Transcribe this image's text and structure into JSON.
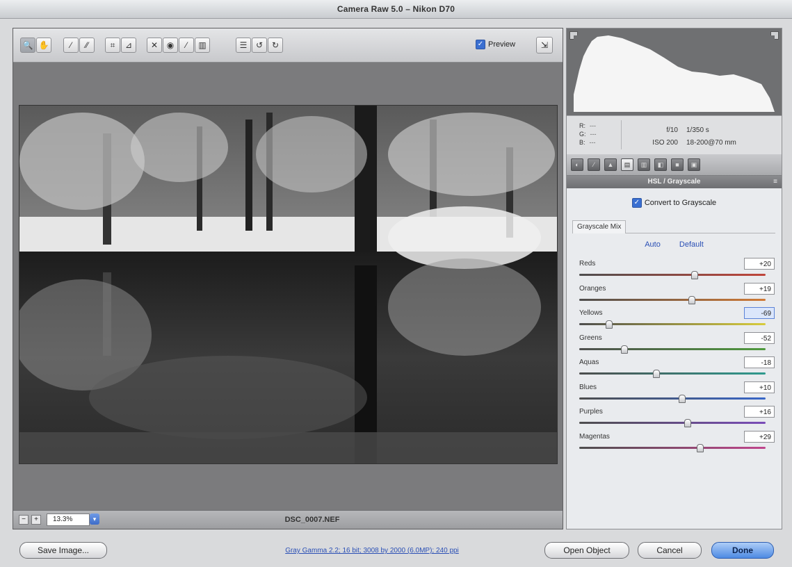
{
  "window": {
    "title": "Camera Raw 5.0  –  Nikon D70"
  },
  "toolbar": {
    "tools": [
      {
        "icon": "zoom-tool-icon",
        "glyph": "🔍"
      },
      {
        "icon": "hand-tool-icon",
        "glyph": "✋"
      },
      {
        "icon": "white-balance-tool-icon",
        "glyph": "⁄"
      },
      {
        "icon": "color-sampler-tool-icon",
        "glyph": "⁄⁄"
      },
      {
        "icon": "crop-tool-icon",
        "glyph": "⌗"
      },
      {
        "icon": "straighten-tool-icon",
        "glyph": "⊿"
      },
      {
        "icon": "spot-removal-tool-icon",
        "glyph": "✕"
      },
      {
        "icon": "red-eye-tool-icon",
        "glyph": "◉"
      },
      {
        "icon": "adjustment-brush-icon",
        "glyph": "⁄"
      },
      {
        "icon": "graduated-filter-icon",
        "glyph": "▥"
      },
      {
        "icon": "preferences-icon",
        "glyph": "☰"
      },
      {
        "icon": "rotate-ccw-icon",
        "glyph": "↺"
      },
      {
        "icon": "rotate-cw-icon",
        "glyph": "↻"
      }
    ],
    "preview_label": "Preview",
    "preview_checked": true,
    "fullscreen_glyph": "⇲"
  },
  "status": {
    "zoom_out_glyph": "−",
    "zoom_in_glyph": "+",
    "zoom_value": "13.3%",
    "filename": "DSC_0007.NEF"
  },
  "readout": {
    "rgb": [
      {
        "label": "R:",
        "value": "---"
      },
      {
        "label": "G:",
        "value": "---"
      },
      {
        "label": "B:",
        "value": "---"
      }
    ],
    "aperture": "f/10",
    "shutter": "1/350 s",
    "iso": "ISO 200",
    "lens": "18-200@70 mm"
  },
  "panel_tabs": [
    "basic-icon",
    "tone-curve-icon",
    "detail-icon",
    "hsl-icon",
    "split-toning-icon",
    "lens-corrections-icon",
    "camera-calibration-icon",
    "presets-icon"
  ],
  "panel": {
    "title": "HSL / Grayscale",
    "menu_glyph": "≡",
    "convert_label": "Convert to Grayscale",
    "mix_title": "Grayscale Mix",
    "auto_label": "Auto",
    "default_label": "Default",
    "sliders": [
      {
        "label": "Reds",
        "value": "+20",
        "fraction": 0.615,
        "gradient": "linear-gradient(to right,#4d4d4d,#c0453a)"
      },
      {
        "label": "Oranges",
        "value": "+19",
        "fraction": 0.6,
        "gradient": "linear-gradient(to right,#4d4d4d,#d17a35)"
      },
      {
        "label": "Yellows",
        "value": "-69",
        "fraction": 0.155,
        "gradient": "linear-gradient(to right,#4d4d4d,#d8cc3c)"
      },
      {
        "label": "Greens",
        "value": "-52",
        "fraction": 0.24,
        "gradient": "linear-gradient(to right,#4d4d4d,#4f9a3d)"
      },
      {
        "label": "Aquas",
        "value": "-18",
        "fraction": 0.41,
        "gradient": "linear-gradient(to right,#4d4d4d,#2f9a8e)"
      },
      {
        "label": "Blues",
        "value": "+10",
        "fraction": 0.55,
        "gradient": "linear-gradient(to right,#4d4d4d,#3866c8)"
      },
      {
        "label": "Purples",
        "value": "+16",
        "fraction": 0.58,
        "gradient": "linear-gradient(to right,#4d4d4d,#7a4cb8)"
      },
      {
        "label": "Magentas",
        "value": "+29",
        "fraction": 0.645,
        "gradient": "linear-gradient(to right,#4d4d4d,#c0458c)"
      }
    ]
  },
  "bottom": {
    "save_label": "Save Image...",
    "workflow_label": "Gray Gamma 2.2; 16 bit; 3008 by 2000 (6.0MP); 240 ppi",
    "open_label": "Open Object",
    "cancel_label": "Cancel",
    "done_label": "Done"
  }
}
